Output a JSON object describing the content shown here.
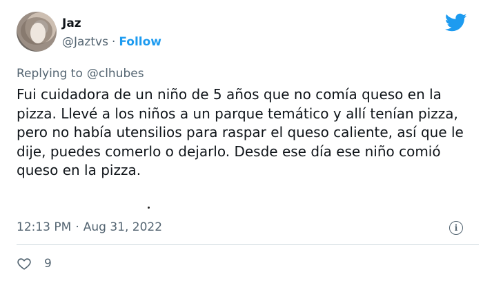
{
  "user": {
    "name": "Jaz",
    "handle": "@Jaztvs",
    "separator": "·",
    "follow_label": "Follow"
  },
  "reply": {
    "prefix": "Replying to",
    "mention": "@clhubes"
  },
  "tweet": {
    "text": "Fui cuidadora de un niño de 5 años que no comía queso en la pizza. Llevé a los niños a un parque temático y allí tenían pizza, pero no había utensilios para raspar el queso caliente, así que le dije, puedes comerlo o dejarlo. Desde ese día ese niño comió queso en la pizza."
  },
  "meta": {
    "time": "12:13 PM",
    "separator": "·",
    "date": "Aug 31, 2022",
    "info_glyph": "i"
  },
  "actions": {
    "like_count": "9"
  },
  "icons": {
    "brand": "twitter-bird-icon",
    "info": "info-icon",
    "like": "heart-icon"
  },
  "colors": {
    "accent": "#1d9bf0",
    "muted": "#536471",
    "text": "#0f1419",
    "divider": "#cfd9de"
  }
}
